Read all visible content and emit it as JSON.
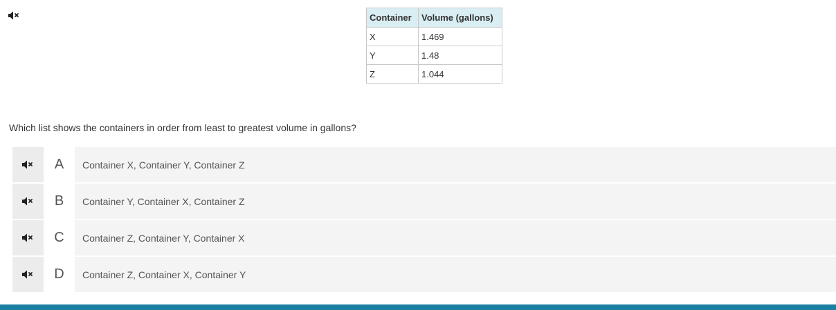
{
  "audio": {
    "icon": "speaker-mute-icon"
  },
  "table": {
    "headers": [
      "Container",
      "Volume (gallons)"
    ],
    "rows": [
      [
        "X",
        "1.469"
      ],
      [
        "Y",
        "1.48"
      ],
      [
        "Z",
        "1.044"
      ]
    ],
    "header_bg": "#d9eef2",
    "border_color": "#c8c8c8"
  },
  "question": {
    "text": "Which list shows the containers in order from least to greatest volume in gallons?"
  },
  "options": [
    {
      "letter": "A",
      "text": "Container X, Container Y, Container Z"
    },
    {
      "letter": "B",
      "text": "Container Y, Container X, Container Z"
    },
    {
      "letter": "C",
      "text": "Container Z, Container Y, Container X"
    },
    {
      "letter": "D",
      "text": "Container Z, Container X, Container Y"
    }
  ],
  "colors": {
    "accent_bar": "#1b7fa3",
    "option_bg": "#f4f4f4"
  }
}
